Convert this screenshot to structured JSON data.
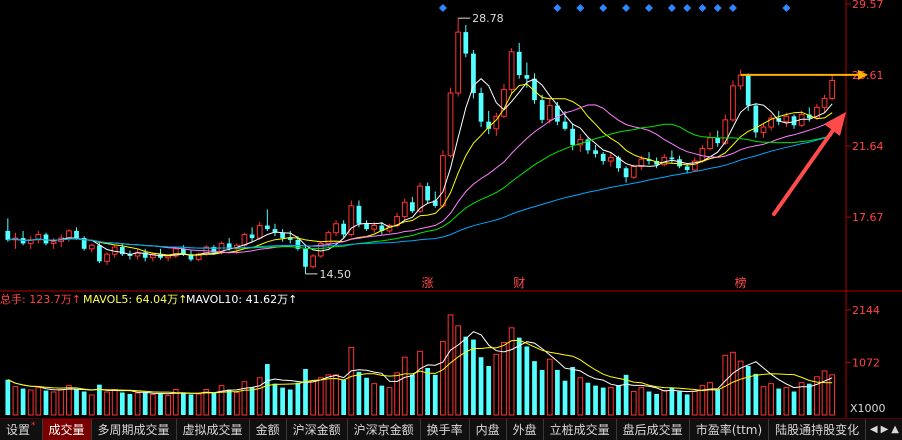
{
  "colors": {
    "up": "#ff3232",
    "down": "#54ffff",
    "ma5": "#ffffff",
    "ma10": "#ffff00",
    "ma20": "#ff80ff",
    "ma30": "#00e600",
    "ma60": "#00a8ff",
    "axis": "#b00000",
    "label": "#ff4444",
    "marker": "#2f86ff",
    "highlight": "#ffb000"
  },
  "chart_data": {
    "type": "candlestick",
    "price_axis_ticks": [
      "29.57",
      "25.61",
      "21.64",
      "17.67"
    ],
    "price_ylim": [
      13.6,
      29.57
    ],
    "annotations": {
      "high_label": "28.78",
      "low_label": "14.50",
      "resistance_label": "25.61"
    },
    "event_labels": [
      "涨",
      "财",
      "榜"
    ],
    "ohlc": [
      [
        16.9,
        17.6,
        16.3,
        16.4
      ],
      [
        16.4,
        16.8,
        15.9,
        16.5
      ],
      [
        16.5,
        16.9,
        16.1,
        16.2
      ],
      [
        16.2,
        16.6,
        15.9,
        16.4
      ],
      [
        16.4,
        16.9,
        16.2,
        16.7
      ],
      [
        16.7,
        16.8,
        16.1,
        16.2
      ],
      [
        16.2,
        16.5,
        15.9,
        16.3
      ],
      [
        16.3,
        16.7,
        16.0,
        16.5
      ],
      [
        16.5,
        17.0,
        16.3,
        16.9
      ],
      [
        16.9,
        17.1,
        16.4,
        16.5
      ],
      [
        16.5,
        16.6,
        15.8,
        15.9
      ],
      [
        15.9,
        16.2,
        15.7,
        16.1
      ],
      [
        16.1,
        16.3,
        15.1,
        15.2
      ],
      [
        15.2,
        15.7,
        15.0,
        15.6
      ],
      [
        15.6,
        16.1,
        15.4,
        16.0
      ],
      [
        16.0,
        16.2,
        15.5,
        15.6
      ],
      [
        15.6,
        15.8,
        15.3,
        15.5
      ],
      [
        15.5,
        15.9,
        15.3,
        15.7
      ],
      [
        15.7,
        15.9,
        15.2,
        15.4
      ],
      [
        15.4,
        15.7,
        15.2,
        15.6
      ],
      [
        15.6,
        15.9,
        15.3,
        15.4
      ],
      [
        15.4,
        15.6,
        15.2,
        15.5
      ],
      [
        15.5,
        16.0,
        15.4,
        15.9
      ],
      [
        15.9,
        16.1,
        15.5,
        15.6
      ],
      [
        15.6,
        15.8,
        15.2,
        15.3
      ],
      [
        15.3,
        15.7,
        15.2,
        15.6
      ],
      [
        15.6,
        16.1,
        15.5,
        16.0
      ],
      [
        16.0,
        16.1,
        15.6,
        15.7
      ],
      [
        15.7,
        16.3,
        15.6,
        16.2
      ],
      [
        16.2,
        16.5,
        15.8,
        15.9
      ],
      [
        15.9,
        16.2,
        15.6,
        16.1
      ],
      [
        16.1,
        16.8,
        16.0,
        16.7
      ],
      [
        16.7,
        17.1,
        16.3,
        16.5
      ],
      [
        16.5,
        17.4,
        16.4,
        17.2
      ],
      [
        17.2,
        18.1,
        16.9,
        17.0
      ],
      [
        17.0,
        17.3,
        16.6,
        16.8
      ],
      [
        16.8,
        17.0,
        16.3,
        16.5
      ],
      [
        16.5,
        16.9,
        16.2,
        16.4
      ],
      [
        16.4,
        16.6,
        15.8,
        15.9
      ],
      [
        15.9,
        16.1,
        14.5,
        14.9
      ],
      [
        14.9,
        15.6,
        14.8,
        15.5
      ],
      [
        15.5,
        16.3,
        15.4,
        16.2
      ],
      [
        16.2,
        16.9,
        16.0,
        16.8
      ],
      [
        16.8,
        17.5,
        16.6,
        17.3
      ],
      [
        17.3,
        17.5,
        16.5,
        16.7
      ],
      [
        16.7,
        18.6,
        16.6,
        18.3
      ],
      [
        18.3,
        18.6,
        17.1,
        17.3
      ],
      [
        17.3,
        17.5,
        16.9,
        17.0
      ],
      [
        17.0,
        17.4,
        16.8,
        17.2
      ],
      [
        17.2,
        17.4,
        16.7,
        16.9
      ],
      [
        16.9,
        17.3,
        16.8,
        17.2
      ],
      [
        17.2,
        17.9,
        17.1,
        17.7
      ],
      [
        17.7,
        18.7,
        17.5,
        18.5
      ],
      [
        18.5,
        18.8,
        17.9,
        18.0
      ],
      [
        18.0,
        19.6,
        17.9,
        19.4
      ],
      [
        19.4,
        19.6,
        18.4,
        18.6
      ],
      [
        18.6,
        19.1,
        18.2,
        18.3
      ],
      [
        18.3,
        21.4,
        18.2,
        21.1
      ],
      [
        21.1,
        24.9,
        21.0,
        24.6
      ],
      [
        24.6,
        28.78,
        24.4,
        28.0
      ],
      [
        28.0,
        28.4,
        26.6,
        26.8
      ],
      [
        26.8,
        27.0,
        24.3,
        24.6
      ],
      [
        24.6,
        24.9,
        22.7,
        23.0
      ],
      [
        23.0,
        23.6,
        22.3,
        22.6
      ],
      [
        22.6,
        23.5,
        22.2,
        23.3
      ],
      [
        23.3,
        25.1,
        23.2,
        24.8
      ],
      [
        24.8,
        27.1,
        24.6,
        26.9
      ],
      [
        26.9,
        27.4,
        25.4,
        25.6
      ],
      [
        25.6,
        26.3,
        24.9,
        25.4
      ],
      [
        25.4,
        25.7,
        24.0,
        24.2
      ],
      [
        24.2,
        24.5,
        22.9,
        23.1
      ],
      [
        23.1,
        24.3,
        22.9,
        23.9
      ],
      [
        23.9,
        24.1,
        22.8,
        23.0
      ],
      [
        23.0,
        23.6,
        22.5,
        22.6
      ],
      [
        22.6,
        22.9,
        21.4,
        21.7
      ],
      [
        21.7,
        22.3,
        21.3,
        22.0
      ],
      [
        22.0,
        22.1,
        21.2,
        21.4
      ],
      [
        21.4,
        21.7,
        21.0,
        21.2
      ],
      [
        21.2,
        21.3,
        20.6,
        20.8
      ],
      [
        20.8,
        21.3,
        20.5,
        21.0
      ],
      [
        21.0,
        21.1,
        20.2,
        20.4
      ],
      [
        20.4,
        20.5,
        19.6,
        19.9
      ],
      [
        19.9,
        20.6,
        19.8,
        20.5
      ],
      [
        20.5,
        21.1,
        20.3,
        20.9
      ],
      [
        20.9,
        21.3,
        20.6,
        20.8
      ],
      [
        20.8,
        21.0,
        20.4,
        20.6
      ],
      [
        20.6,
        21.2,
        20.5,
        21.0
      ],
      [
        21.0,
        21.4,
        20.7,
        20.9
      ],
      [
        20.9,
        21.1,
        20.4,
        20.5
      ],
      [
        20.5,
        20.7,
        20.1,
        20.3
      ],
      [
        20.3,
        21.0,
        20.2,
        20.8
      ],
      [
        20.8,
        21.7,
        20.7,
        21.5
      ],
      [
        21.5,
        22.4,
        21.4,
        22.1
      ],
      [
        22.1,
        22.5,
        21.6,
        21.8
      ],
      [
        21.8,
        23.4,
        21.7,
        23.1
      ],
      [
        23.1,
        25.3,
        23.0,
        25.0
      ],
      [
        25.0,
        25.9,
        24.8,
        25.6
      ],
      [
        25.6,
        25.7,
        23.6,
        23.9
      ],
      [
        23.9,
        24.0,
        22.1,
        22.4
      ],
      [
        22.4,
        22.9,
        22.1,
        22.7
      ],
      [
        22.7,
        23.4,
        22.5,
        23.2
      ],
      [
        23.2,
        23.6,
        22.8,
        23.0
      ],
      [
        23.0,
        23.5,
        22.7,
        23.3
      ],
      [
        23.3,
        23.4,
        22.6,
        22.8
      ],
      [
        22.8,
        23.6,
        22.7,
        23.4
      ],
      [
        23.4,
        23.8,
        23.0,
        23.2
      ],
      [
        23.2,
        24.0,
        23.1,
        23.8
      ],
      [
        23.8,
        24.5,
        23.5,
        24.3
      ],
      [
        24.3,
        25.6,
        24.2,
        25.3
      ]
    ],
    "volume_title": "总手: 123.7万↑",
    "mavol5_label": "MAVOL5: 64.04万↑",
    "mavol10_label": "MAVOL10: 41.62万↑",
    "volume_axis_ticks": [
      "2144",
      "1072"
    ],
    "volume_unit": "X1000",
    "volume_ylim": [
      0,
      2144
    ],
    "volume": [
      720,
      580,
      540,
      510,
      560,
      500,
      470,
      520,
      600,
      530,
      480,
      410,
      620,
      470,
      520,
      460,
      430,
      450,
      460,
      420,
      440,
      400,
      520,
      450,
      420,
      430,
      520,
      460,
      600,
      520,
      460,
      680,
      560,
      760,
      1040,
      640,
      560,
      520,
      660,
      940,
      700,
      760,
      820,
      820,
      720,
      1380,
      880,
      760,
      640,
      600,
      560,
      860,
      1180,
      820,
      1300,
      960,
      820,
      1500,
      2044,
      1820,
      1600,
      1540,
      1180,
      1000,
      1240,
      1480,
      1780,
      1580,
      1400,
      1100,
      920,
      1140,
      920,
      700,
      980,
      760,
      660,
      600,
      560,
      560,
      600,
      820,
      480,
      560,
      480,
      430,
      500,
      560,
      480,
      420,
      480,
      600,
      660,
      520,
      1220,
      1280,
      1100,
      1000,
      840,
      580,
      640,
      540,
      560,
      480,
      660,
      640,
      780,
      900,
      820
    ]
  },
  "tabs": [
    {
      "label": "设置",
      "active": false,
      "star": true
    },
    {
      "label": "成交量",
      "active": true,
      "star": false
    },
    {
      "label": "多周期成交量",
      "active": false,
      "star": false
    },
    {
      "label": "虚拟成交量",
      "active": false,
      "star": false
    },
    {
      "label": "金额",
      "active": false,
      "star": false
    },
    {
      "label": "沪深金额",
      "active": false,
      "star": false
    },
    {
      "label": "沪深京金额",
      "active": false,
      "star": false
    },
    {
      "label": "换手率",
      "active": false,
      "star": false
    },
    {
      "label": "内盘",
      "active": false,
      "star": false
    },
    {
      "label": "外盘",
      "active": false,
      "star": false
    },
    {
      "label": "立桩成交量",
      "active": false,
      "star": false
    },
    {
      "label": "盘后成交量",
      "active": false,
      "star": false
    },
    {
      "label": "市盈率(ttm)",
      "active": false,
      "star": false
    },
    {
      "label": "陆股通持股变化",
      "active": false,
      "star": false
    }
  ],
  "tab_scroll": {
    "left": "◀",
    "right": "▶",
    "more": "▲"
  }
}
